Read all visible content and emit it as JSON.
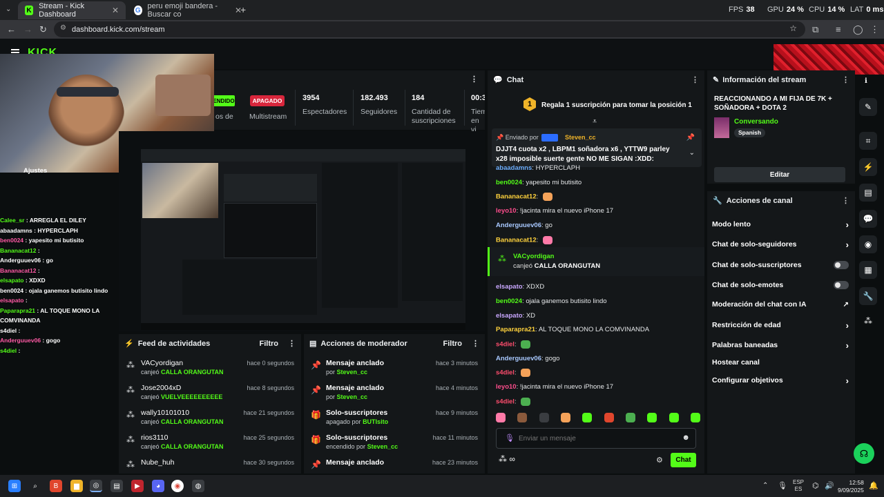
{
  "browser": {
    "tabs": [
      {
        "title": "Stream - Kick Dashboard",
        "favicon": "kick-icon"
      },
      {
        "title": "peru emoji bandera - Buscar co",
        "favicon": "google-icon"
      }
    ],
    "url": "dashboard.kick.com/stream",
    "perf": {
      "fps_label": "FPS",
      "fps": "38",
      "gpu_label": "GPU",
      "gpu": "24 %",
      "cpu_label": "CPU",
      "cpu": "14 %",
      "lat_label": "LAT",
      "lat": "0 ms"
    }
  },
  "stream_info_bar": {
    "status_label": "ENDIDO",
    "partial_label": "os de",
    "multistream_badge": "APAGADO",
    "multistream_label": "Multistream",
    "stats": [
      {
        "value": "3954",
        "label": "Espectadores"
      },
      {
        "value": "182.493",
        "label": "Seguidores"
      },
      {
        "value": "184",
        "label": "Cantidad de suscripciones"
      },
      {
        "value": "00:3",
        "label": "Tiem en vi"
      }
    ]
  },
  "overlay": {
    "settings_label": "Ajustes",
    "chat": [
      {
        "user": "Calee_sr",
        "text": "ARREGLA EL DILEY"
      },
      {
        "user": "abaadamns",
        "text": "HYPERCLAPH"
      },
      {
        "user": "ben0024",
        "text": "yapesito mi butisito"
      },
      {
        "user": "Bananacat12",
        "text": ""
      },
      {
        "user": "Anderguuev06",
        "text": "go"
      },
      {
        "user": "Bananacat12",
        "text": ""
      },
      {
        "user": "elsapato",
        "text": "XDXD"
      },
      {
        "user": "ben0024",
        "text": "ojala ganemos butisito lindo"
      },
      {
        "user": "elsapato",
        "text": ""
      },
      {
        "user": "Paparapra21",
        "text": "AL TOQUE MONO LA COMVINANDA"
      },
      {
        "user": "s4diel",
        "text": ""
      },
      {
        "user": "Anderguuev06",
        "text": "gogo"
      },
      {
        "user": "s4diel",
        "text": ""
      }
    ]
  },
  "activity_feed": {
    "title": "Feed de actividades",
    "filter": "Filtro",
    "items": [
      {
        "user": "VACyordigan",
        "action": "canjeó",
        "reward": "CALLA ORANGUTAN",
        "time": "hace 0 segundos"
      },
      {
        "user": "Jose2004xD",
        "action": "canjeó",
        "reward": "VUELVEEEEEEEEEE",
        "time": "hace 8 segundos"
      },
      {
        "user": "wally10101010",
        "action": "canjeó",
        "reward": "CALLA ORANGUTAN",
        "time": "hace 21 segundos"
      },
      {
        "user": "rios3110",
        "action": "canjeó",
        "reward": "CALLA ORANGUTAN",
        "time": "hace 25 segundos"
      },
      {
        "user": "Nube_huh",
        "action": "",
        "reward": "",
        "time": "hace 30 segundos"
      }
    ]
  },
  "mod_actions": {
    "title": "Acciones de moderador",
    "filter": "Filtro",
    "items": [
      {
        "title": "Mensaje anclado",
        "by": "por",
        "actor": "Steven_cc",
        "time": "hace 3 minutos",
        "icon": "pin-icon"
      },
      {
        "title": "Mensaje anclado",
        "by": "por",
        "actor": "Steven_cc",
        "time": "hace 4 minutos",
        "icon": "pin-icon"
      },
      {
        "title": "Solo-suscriptores",
        "by": "apagado por",
        "actor": "BUTIsito",
        "time": "hace 9 minutos",
        "icon": "gift-icon"
      },
      {
        "title": "Solo-suscriptores",
        "by": "encendido por",
        "actor": "Steven_cc",
        "time": "hace 11 minutos",
        "icon": "gift-icon"
      },
      {
        "title": "Mensaje anclado",
        "by": "",
        "actor": "",
        "time": "hace 23 minutos",
        "icon": "pin-icon"
      }
    ]
  },
  "chat": {
    "title": "Chat",
    "sub_banner": "Regala 1 suscripción para tomar la posición 1",
    "sub_rank": "1",
    "pinned": {
      "sent_by": "Enviado por",
      "user": "Steven_cc",
      "text": "DJJT4 cuota x2 , LBPM1 soñadora x6 , YTTW9 parley x28 imposible suerte gente NO ME SIGAN :XDD:"
    },
    "messages": [
      {
        "user": "abaadamns",
        "text": "HYPERCLAPH",
        "color": "#6fb0ff"
      },
      {
        "user": "ben0024",
        "text": "yapesito mi butisito",
        "color": "#53fc18"
      },
      {
        "user": "Bananacat12",
        "text": "",
        "color": "#ffd23d"
      },
      {
        "user": "leyo10",
        "text": "!jacinta mira el nuevo iPhone 17",
        "color": "#ff4d8d"
      },
      {
        "user": "Anderguuev06",
        "text": "go",
        "color": "#a8c8ff"
      },
      {
        "user": "Bananacat12",
        "text": "",
        "color": "#ffd23d"
      }
    ],
    "redeem": {
      "user": "VACyordigan",
      "action": "canjeó",
      "reward": "CALLA ORANGUTAN"
    },
    "messages2": [
      {
        "user": "elsapato",
        "text": "XDXD",
        "color": "#c9a7ff"
      },
      {
        "user": "ben0024",
        "text": "ojala ganemos butisito lindo",
        "color": "#53fc18"
      },
      {
        "user": "elsapato",
        "text": "XD",
        "color": "#c9a7ff"
      },
      {
        "user": "Paparapra21",
        "text": "AL TOQUE MONO LA COMVINANDA",
        "color": "#ffd23d"
      },
      {
        "user": "s4diel",
        "text": "",
        "color": "#ff4d6d"
      },
      {
        "user": "Anderguuev06",
        "text": "gogo",
        "color": "#a8c8ff"
      },
      {
        "user": "s4diel",
        "text": "",
        "color": "#ff4d6d"
      },
      {
        "user": "leyo10",
        "text": "!jacinta mira el nuevo iPhone 17",
        "color": "#ff4d8d"
      },
      {
        "user": "s4diel",
        "text": "",
        "color": "#ff4d6d"
      }
    ],
    "input_placeholder": "Enviar un mensaje",
    "send_label": "Chat"
  },
  "stream_info": {
    "title": "Información del stream",
    "stream_title": "REACCIONANDO A MI FIJA DE 7K + SOÑADORA + DOTA 2",
    "category": "Conversando",
    "language": "Spanish",
    "edit_label": "Editar"
  },
  "channel_actions": {
    "title": "Acciones de canal",
    "items": [
      {
        "label": "Modo lento",
        "kind": "chevron"
      },
      {
        "label": "Chat de solo-seguidores",
        "kind": "chevron"
      },
      {
        "label": "Chat de solo-suscriptores",
        "kind": "toggle"
      },
      {
        "label": "Chat de solo-emotes",
        "kind": "toggle"
      },
      {
        "label": "Moderación del chat con IA",
        "kind": "external"
      },
      {
        "label": "Restricción de edad",
        "kind": "chevron"
      },
      {
        "label": "Palabras baneadas",
        "kind": "chevron"
      },
      {
        "label": "Hostear canal",
        "kind": "none"
      },
      {
        "label": "Configurar objetivos",
        "kind": "chevron"
      }
    ]
  },
  "taskbar": {
    "lang": "ESP",
    "lang2": "ES",
    "time": "12:58",
    "date": "9/09/2025"
  },
  "colors": {
    "accent": "#53fc18",
    "panel": "#141719",
    "bg": "#0b0e0f",
    "apagado": "#d8263c"
  }
}
